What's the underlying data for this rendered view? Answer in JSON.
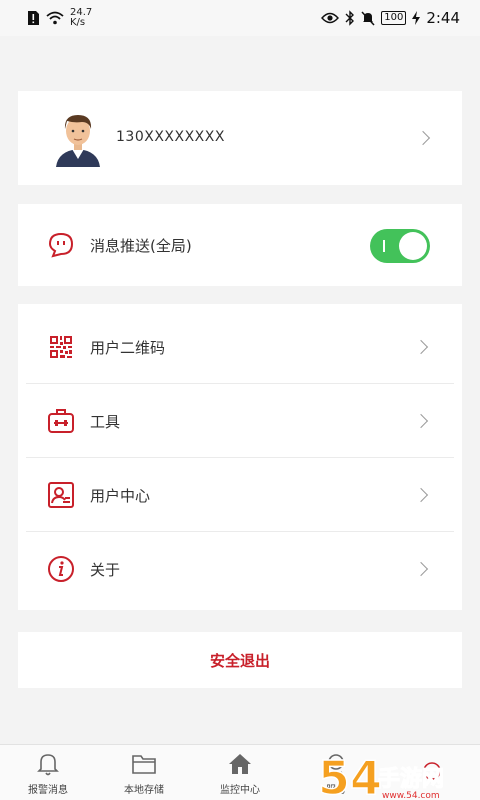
{
  "status_bar": {
    "net_speed_value": "24.7",
    "net_speed_unit": "K/s",
    "battery": "100",
    "time": "2:44"
  },
  "profile": {
    "phone": "130XXXXXXXX"
  },
  "push": {
    "label": "消息推送(全局)",
    "enabled": true
  },
  "menu": {
    "items": [
      {
        "label": "用户二维码",
        "icon": "qr-code-icon"
      },
      {
        "label": "工具",
        "icon": "toolbox-icon"
      },
      {
        "label": "用户中心",
        "icon": "user-card-icon"
      },
      {
        "label": "关于",
        "icon": "info-icon"
      }
    ]
  },
  "logout": {
    "label": "安全退出"
  },
  "bottom_nav": {
    "items": [
      {
        "label": "报警消息",
        "icon": "bell-icon"
      },
      {
        "label": "本地存储",
        "icon": "folder-icon"
      },
      {
        "label": "监控中心",
        "icon": "home-icon"
      },
      {
        "label": "服务",
        "icon": "service-icon"
      },
      {
        "label": "",
        "icon": "more-icon"
      }
    ]
  },
  "watermark": {
    "text": "54手游网"
  },
  "colors": {
    "accent_red": "#c8202a",
    "toggle_green": "#43c25a",
    "background": "#f3f3f3"
  }
}
